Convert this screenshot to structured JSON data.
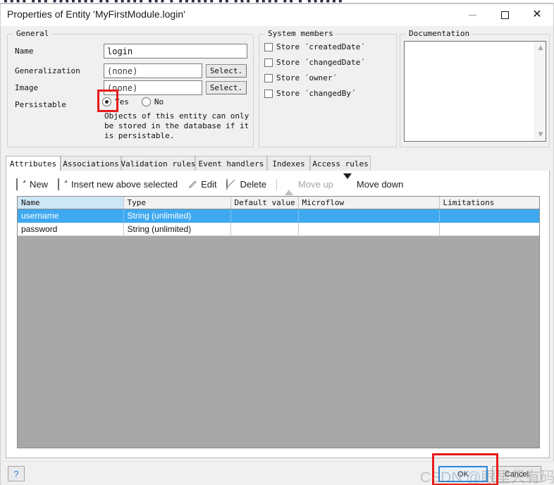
{
  "window": {
    "title": "Properties of Entity 'MyFirstModule.login'",
    "minimize_label": "–",
    "maximize_label": "□",
    "close_label": "✕",
    "background_strip_text": "▌▌▌▌ ▌▌▌ ▌▌▌▌▌▌▌ ▌▌ ▌▌▌▌▌ ▌▌▌ ▌ ▌▌▌▌▌▌ ▌▌ ▌▌▌ ▌▌▌▌ ▌▌ ▌ ▌▌▌▌▌▌"
  },
  "general": {
    "legend": "General",
    "name_label": "Name",
    "name_value": "login",
    "generalization_label": "Generalization",
    "generalization_value": "(none)",
    "generalization_button": "Select.",
    "image_label": "Image",
    "image_value": "(none)",
    "image_button": "Select.",
    "persistable_label": "Persistable",
    "persistable_yes": "Yes",
    "persistable_no": "No",
    "persistable_selected": "Yes",
    "hint_line1": "Objects of this entity can only",
    "hint_line2": "be stored in the database if it",
    "hint_line3": "is persistable."
  },
  "system_members": {
    "legend": "System members",
    "items": [
      {
        "label": "Store ´createdDate´",
        "checked": false
      },
      {
        "label": "Store ´changedDate´",
        "checked": false
      },
      {
        "label": "Store ´owner´",
        "checked": false
      },
      {
        "label": "Store ´changedBy´",
        "checked": false
      }
    ]
  },
  "documentation": {
    "legend": "Documentation",
    "value": "",
    "scroll_up": "▲",
    "scroll_down": "▼"
  },
  "tabs": [
    {
      "label": "Attributes",
      "active": true
    },
    {
      "label": "Associations",
      "active": false
    },
    {
      "label": "Validation rules",
      "active": false
    },
    {
      "label": "Event handlers",
      "active": false
    },
    {
      "label": "Indexes",
      "active": false
    },
    {
      "label": "Access rules",
      "active": false
    }
  ],
  "toolbar": [
    {
      "label": "New",
      "icon": "document-icon",
      "disabled": false
    },
    {
      "label": "Insert new above selected",
      "icon": "document-icon",
      "disabled": false
    },
    {
      "label": "Edit",
      "icon": "pencil-icon",
      "disabled": false
    },
    {
      "label": "Delete",
      "icon": "no-entry-icon",
      "disabled": false
    },
    {
      "label": "Move up",
      "icon": "triangle-up-icon",
      "disabled": true
    },
    {
      "label": "Move down",
      "icon": "triangle-down-icon",
      "disabled": false
    }
  ],
  "table": {
    "columns": [
      "Name",
      "Type",
      "Default value",
      "Microflow",
      "Limitations"
    ],
    "sorted_column": "Name",
    "rows": [
      {
        "selected": true,
        "cells": [
          "username",
          "String (unlimited)",
          "",
          "",
          ""
        ]
      },
      {
        "selected": false,
        "cells": [
          "password",
          "String (unlimited)",
          "",
          "",
          ""
        ]
      }
    ]
  },
  "footer": {
    "help_label": "?",
    "ok_label": "OK",
    "cancel_label": "Cancel",
    "watermark": "CSDN @眼里只有码"
  },
  "colors": {
    "selection_blue": "#3fa9f0",
    "sorted_header_blue": "#cfe6f7",
    "annotation_red": "#e81a1a",
    "default_button_blue": "#2a86d8",
    "dialog_gray": "#f0f0f0",
    "grid_empty_gray": "#a8a8a8"
  }
}
